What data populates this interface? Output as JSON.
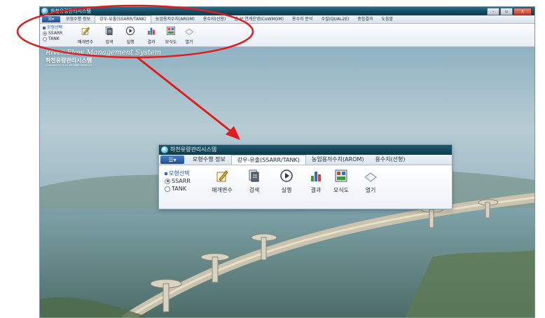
{
  "window": {
    "title": "하천유량관리시스템",
    "controls": {
      "minimize": "-",
      "maximize": "▫",
      "close": "x"
    }
  },
  "tabs": [
    {
      "label": "모형수행 정보",
      "active": false
    },
    {
      "label": "강우-유출(SSARR/TANK)",
      "active": true
    },
    {
      "label": "농업용저수지(AROM)",
      "active": false
    },
    {
      "label": "용수지(선형)",
      "active": false
    },
    {
      "label": "댐-보 연계운영(CoWMOM)",
      "active": false
    },
    {
      "label": "용수지 분석",
      "active": false
    },
    {
      "label": "수질(QUAL2E)",
      "active": false
    },
    {
      "label": "종합결과",
      "active": false
    },
    {
      "label": "도움말",
      "active": false
    }
  ],
  "ribbon": {
    "model_header": "모형선택",
    "model_options": [
      {
        "label": "SSARR",
        "selected": true
      },
      {
        "label": "TANK",
        "selected": false
      }
    ],
    "buttons": [
      {
        "label": "매개변수",
        "icon": "pencil-notepad-icon"
      },
      {
        "label": "검색",
        "icon": "search-document-icon"
      },
      {
        "label": "실행",
        "icon": "play-icon"
      },
      {
        "label": "결과",
        "icon": "result-chart-icon"
      },
      {
        "label": "모식도",
        "icon": "diagram-icon"
      },
      {
        "label": "열기",
        "icon": "open-book-icon"
      }
    ]
  },
  "background": {
    "title_en": "River Flow Management System",
    "title_ko": "하천유량관리시스템",
    "copyright": "Copyright © 2010. All Right Reserved"
  },
  "zoom": {
    "title": "하천유량관리시스템",
    "tabs": [
      {
        "label": "모형수행 정보",
        "active": false
      },
      {
        "label": "강우-유출(SSARR/TANK)",
        "active": true
      },
      {
        "label": "농업용저수지(AROM)",
        "active": false
      },
      {
        "label": "용수지(선형)",
        "active": false
      }
    ],
    "model_header": "모형선택",
    "model_options": [
      {
        "label": "SSARR",
        "selected": true
      },
      {
        "label": "TANK",
        "selected": false
      }
    ],
    "buttons": [
      {
        "label": "매개변수",
        "icon": "pencil-notepad-icon"
      },
      {
        "label": "검색",
        "icon": "search-document-icon"
      },
      {
        "label": "실행",
        "icon": "play-icon"
      },
      {
        "label": "결과",
        "icon": "result-chart-icon"
      },
      {
        "label": "모식도",
        "icon": "diagram-icon"
      },
      {
        "label": "열기",
        "icon": "open-book-icon"
      }
    ]
  },
  "annotation": {
    "ellipse_color": "#e01c1c",
    "arrow_color": "#e01c1c"
  }
}
